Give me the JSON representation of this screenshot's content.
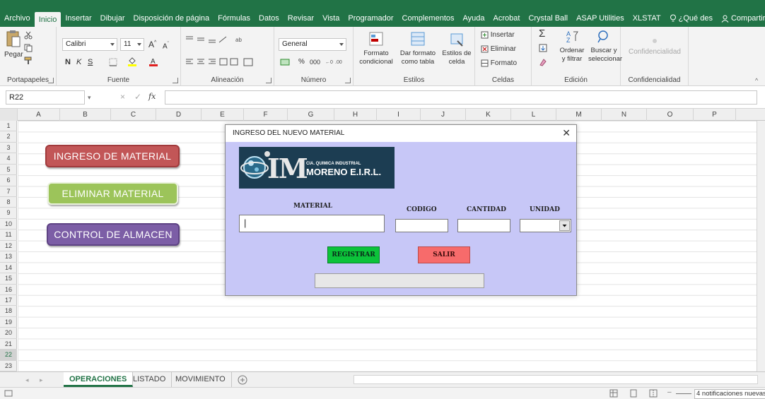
{
  "ribbon_tabs": [
    "Archivo",
    "Inicio",
    "Insertar",
    "Dibujar",
    "Disposición de página",
    "Fórmulas",
    "Datos",
    "Revisar",
    "Vista",
    "Programador",
    "Complementos",
    "Ayuda",
    "Acrobat",
    "Crystal Ball",
    "ASAP Utilities",
    "XLSTAT"
  ],
  "active_tab": "Inicio",
  "tell_me": "¿Qué des",
  "share": "Compartir",
  "clipboard": {
    "paste": "Pegar",
    "label": "Portapapeles"
  },
  "font": {
    "name": "Calibri",
    "size": "11",
    "bold": "N",
    "italic": "K",
    "underline": "S",
    "label": "Fuente"
  },
  "alignment": {
    "label": "Alineación"
  },
  "number": {
    "format": "General",
    "percent": "%",
    "thousands": "000",
    "label": "Número"
  },
  "styles": {
    "conditional": "Formato condicional",
    "as_table": "Dar formato como tabla",
    "cell_styles": "Estilos de celda",
    "label": "Estilos"
  },
  "cells": {
    "insert": "Insertar",
    "delete": "Eliminar",
    "format": "Formato",
    "label": "Celdas"
  },
  "editing": {
    "sort": "Ordenar y filtrar",
    "find": "Buscar y seleccionar",
    "label": "Edición"
  },
  "sensitivity": {
    "button": "Confidencialidad",
    "label": "Confidencialidad"
  },
  "formula_bar": {
    "name_box": "R22",
    "fx": "fx",
    "value": ""
  },
  "columns": [
    "A",
    "B",
    "C",
    "D",
    "E",
    "F",
    "G",
    "H",
    "I",
    "J",
    "K",
    "L",
    "M",
    "N",
    "O",
    "P"
  ],
  "rows": [
    "1",
    "2",
    "3",
    "4",
    "5",
    "6",
    "7",
    "8",
    "9",
    "10",
    "11",
    "12",
    "13",
    "14",
    "15",
    "16",
    "17",
    "18",
    "19",
    "20",
    "21",
    "22",
    "23"
  ],
  "selected_row": "22",
  "macro_buttons": {
    "ingreso": "INGRESO DE MATERIAL",
    "eliminar": "ELIMINAR MATERIAL",
    "control": "CONTROL DE ALMACEN"
  },
  "dialog": {
    "title": "INGRESO DEL NUEVO MATERIAL",
    "logo_small": "CIA. QUIMICA INDUSTRIAL",
    "logo_big": "MORENO E.I.R.L.",
    "logo_letters": "IM",
    "material_label": "MATERIAL",
    "codigo_label": "CODIGO",
    "cantidad_label": "CANTIDAD",
    "unidad_label": "UNIDAD",
    "material_value": "|",
    "codigo_value": "",
    "cantidad_value": "",
    "unidad_value": "",
    "register": "REGISTRAR",
    "exit": "SALIR",
    "status": ""
  },
  "sheets": [
    "OPERACIONES",
    "LISTADO",
    "MOVIMIENTO"
  ],
  "active_sheet": "OPERACIONES",
  "status": {
    "notifications": "4 notificaciones nuevas"
  },
  "colors": {
    "excel_green": "#217346",
    "dialog_bg": "#c7c7f7",
    "ingreso": "#c25657",
    "eliminar": "#9cc45a",
    "control": "#7c5ea6",
    "registrar": "#0cc33a",
    "salir": "#f76b6b"
  }
}
